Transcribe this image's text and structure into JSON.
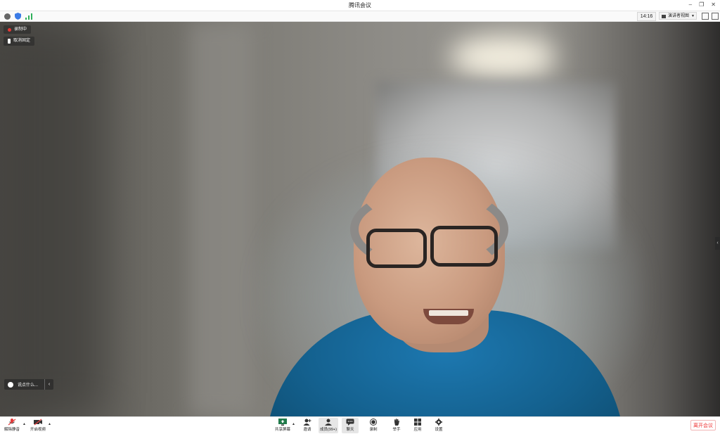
{
  "window": {
    "title": "腾讯会议"
  },
  "topbar": {
    "time": "14:16",
    "view_label": "演讲者视图",
    "colors": {
      "info": "#666666",
      "shield": "#3b7be6",
      "signal": "#2fb05a"
    }
  },
  "video": {
    "recording_label": "录制中",
    "unpin_label": "取消固定",
    "chat_placeholder": "说点什么..."
  },
  "toolbar": {
    "unmute_label": "解除静音",
    "start_video_label": "开启视频",
    "share_screen_label": "共享屏幕",
    "invite_label": "邀请",
    "members_label": "成员(99+)",
    "chat_label": "聊天",
    "record_label": "录制",
    "raise_hand_label": "举手",
    "apps_label": "应用",
    "settings_label": "设置",
    "leave_label": "离开会议",
    "colors": {
      "mic_muted": "#e33b3b",
      "leave": "#e33333"
    }
  }
}
